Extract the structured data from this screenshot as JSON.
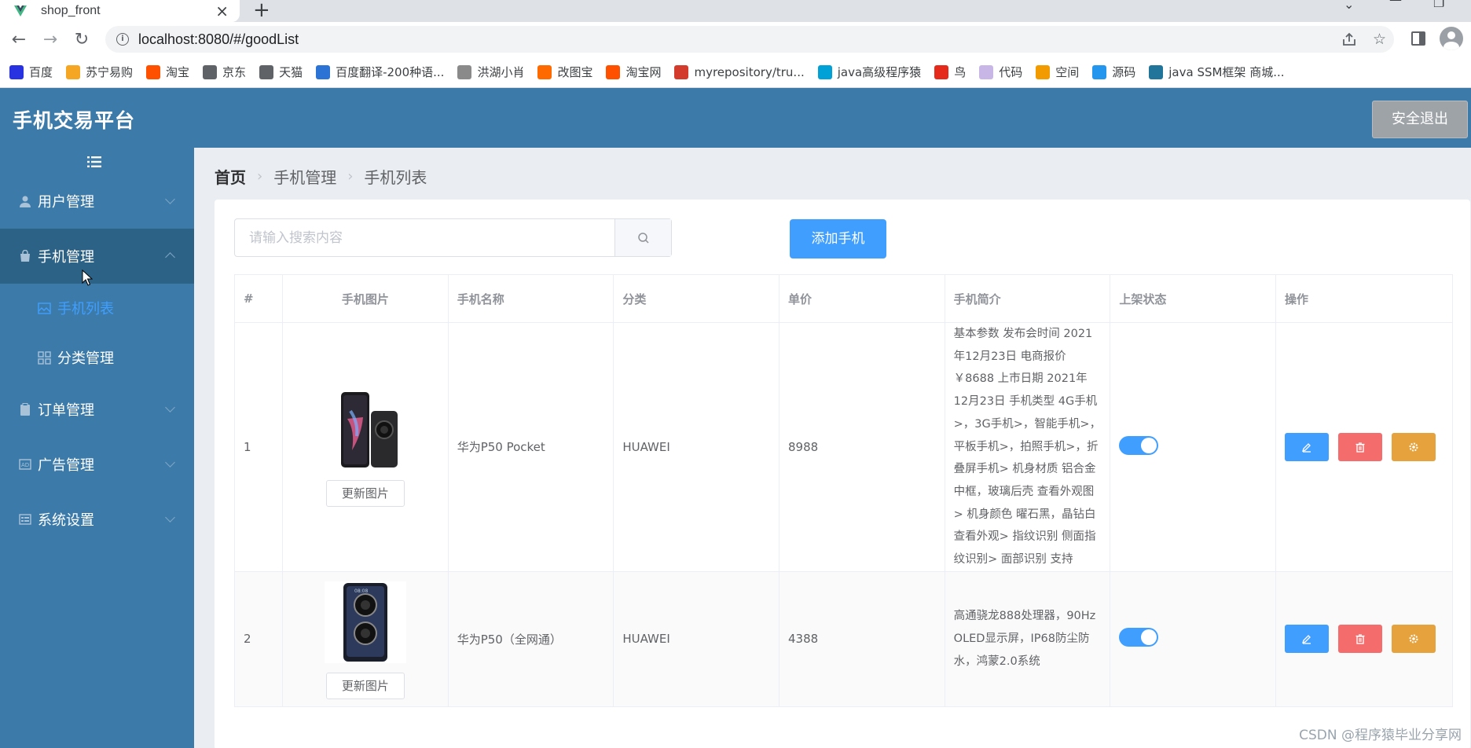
{
  "browser": {
    "tab_title": "shop_front",
    "url": "localhost:8080/#/goodList",
    "bookmarks": [
      {
        "label": "百度",
        "color": "#2932e1"
      },
      {
        "label": "苏宁易购",
        "color": "#f5a623"
      },
      {
        "label": "淘宝",
        "color": "#ff5000"
      },
      {
        "label": "京东",
        "color": "#5f6368"
      },
      {
        "label": "天猫",
        "color": "#5f6368"
      },
      {
        "label": "百度翻译-200种语...",
        "color": "#2b73d4"
      },
      {
        "label": "洪湖小肖",
        "color": "#8a8a8a"
      },
      {
        "label": "改图宝",
        "color": "#ff6a00"
      },
      {
        "label": "淘宝网",
        "color": "#ff5000"
      },
      {
        "label": "myrepository/tru...",
        "color": "#d33b2c"
      },
      {
        "label": "java高级程序猿",
        "color": "#00a1d6"
      },
      {
        "label": "鸟",
        "color": "#e52a1b"
      },
      {
        "label": "代码",
        "color": "#c8b7e6"
      },
      {
        "label": "空间",
        "color": "#f29b00"
      },
      {
        "label": "源码",
        "color": "#2496ed"
      },
      {
        "label": "java SSM框架 商城...",
        "color": "#21759b"
      }
    ]
  },
  "app": {
    "title": "手机交易平台",
    "logout_label": "安全退出"
  },
  "sidebar": {
    "menus": [
      {
        "label": "用户管理",
        "icon": "user-icon"
      },
      {
        "label": "手机管理",
        "icon": "bag-icon"
      },
      {
        "label": "订单管理",
        "icon": "clipboard-icon"
      },
      {
        "label": "广告管理",
        "icon": "ad-icon"
      },
      {
        "label": "系统设置",
        "icon": "settings-list-icon"
      }
    ],
    "submenus": [
      {
        "label": "手机列表",
        "icon": "picture-icon"
      },
      {
        "label": "分类管理",
        "icon": "grid-icon"
      }
    ]
  },
  "breadcrumb": {
    "home": "首页",
    "level1": "手机管理",
    "level2": "手机列表"
  },
  "toolbar": {
    "search_placeholder": "请输入搜索内容",
    "add_label": "添加手机"
  },
  "table": {
    "headers": [
      "#",
      "手机图片",
      "手机名称",
      "分类",
      "单价",
      "手机简介",
      "上架状态",
      "操作"
    ],
    "update_image_label": "更新图片",
    "rows": [
      {
        "index": "1",
        "name": "华为P50 Pocket",
        "category": "HUAWEI",
        "price": "8988",
        "desc": "基本参数 发布会时间 2021年12月23日 电商报价 ￥8688 上市日期 2021年12月23日 手机类型 4G手机>，3G手机>，智能手机>，平板手机>，拍照手机>，折叠屏手机> 机身材质 铝合金中框，玻璃后壳 查看外观图> 机身颜色 曜石黑，晶钻白 查看外观> 指纹识别 侧面指纹识别> 面部识别 支持",
        "on_sale": true
      },
      {
        "index": "2",
        "name": "华为P50（全网通）",
        "category": "HUAWEI",
        "price": "4388",
        "desc": "高通骁龙888处理器，90Hz OLED显示屏，IP68防尘防水，鸿蒙2.0系统",
        "on_sale": true
      }
    ]
  },
  "watermark": "CSDN @程序猿毕业分享网",
  "colors": {
    "header_bg": "#3c7ba9",
    "active_menu_bg": "#2c6286",
    "primary": "#409eff",
    "danger": "#f56c6c",
    "warning": "#e6a23c"
  }
}
